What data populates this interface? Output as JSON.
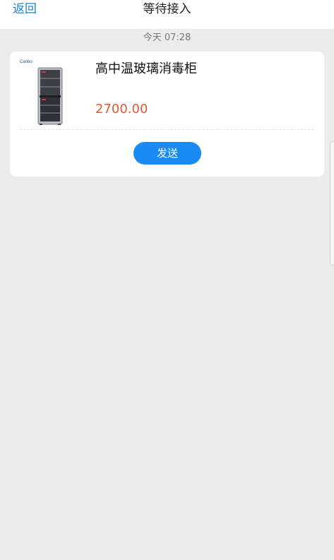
{
  "header": {
    "back_label": "返回",
    "title": "等待接入"
  },
  "timestamp": "今天  07:28",
  "card": {
    "product_name": "高中温玻璃消毒柜",
    "price": "2700.00",
    "brand_logo_text": "Canbo",
    "send_label": "发送"
  },
  "colors": {
    "accent": "#1a83d6",
    "button_bg": "#1a8bf3",
    "price": "#e05a36",
    "background": "#ececec"
  },
  "icons": {
    "product": "disinfection-cabinet-image"
  }
}
